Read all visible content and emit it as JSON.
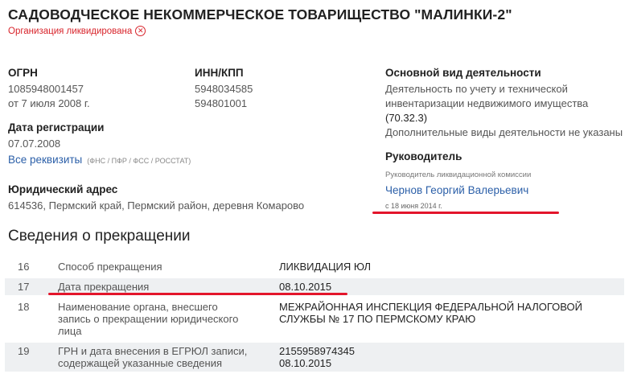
{
  "org": {
    "title": "САДОВОДЧЕСКОЕ НЕКОММЕРЧЕСКОЕ ТОВАРИЩЕСТВО \"МАЛИНКИ-2\"",
    "status": "Организация ликвидирована",
    "status_icon": "close-circle-icon"
  },
  "ogrn": {
    "label": "ОГРН",
    "value": "1085948001457",
    "date": "от 7 июля 2008 г."
  },
  "inn": {
    "label": "ИНН/КПП",
    "inn": "5948034585",
    "kpp": "594801001"
  },
  "reg": {
    "label": "Дата регистрации",
    "value": "07.07.2008"
  },
  "requisites": {
    "link": "Все реквизиты",
    "sources": "(ФНС / ПФР / ФСС / РОССТАТ)"
  },
  "address": {
    "label": "Юридический адрес",
    "value": "614536, Пермский край, Пермский район, деревня Комарово"
  },
  "activity": {
    "label": "Основной вид деятельности",
    "line1": "Деятельность по учету и технической",
    "line2": "инвентаризации недвижимого имущества",
    "code": "(70.32.3)",
    "extra": "Дополнительные виды деятельности не указаны"
  },
  "head": {
    "label": "Руководитель",
    "role": "Руководитель ликвидационной комиссии",
    "name": "Чернов Георгий Валерьевич",
    "since": "с 18 июня 2014 г."
  },
  "termination": {
    "title": "Сведения о прекращении",
    "rows": [
      {
        "n": "16",
        "k1": "Способ прекращения",
        "k2": "",
        "k3": "",
        "v1": "ЛИКВИДАЦИЯ ЮЛ",
        "v2": ""
      },
      {
        "n": "17",
        "k1": "Дата прекращения",
        "k2": "",
        "k3": "",
        "v1": "08.10.2015",
        "v2": ""
      },
      {
        "n": "18",
        "k1": "Наименование органа, внесшего",
        "k2": "запись о прекращении юридического",
        "k3": "лица",
        "v1": "МЕЖРАЙОННАЯ ИНСПЕКЦИЯ ФЕДЕРАЛЬНОЙ НАЛОГОВОЙ",
        "v2": "СЛУЖБЫ № 17 ПО ПЕРМСКОМУ КРАЮ"
      },
      {
        "n": "19",
        "k1": "ГРН и дата внесения в ЕГРЮЛ записи,",
        "k2": "содержащей указанные сведения",
        "k3": "",
        "v1": "2155958974345",
        "v2": "08.10.2015"
      }
    ]
  },
  "annotation_color": "#e3152b"
}
